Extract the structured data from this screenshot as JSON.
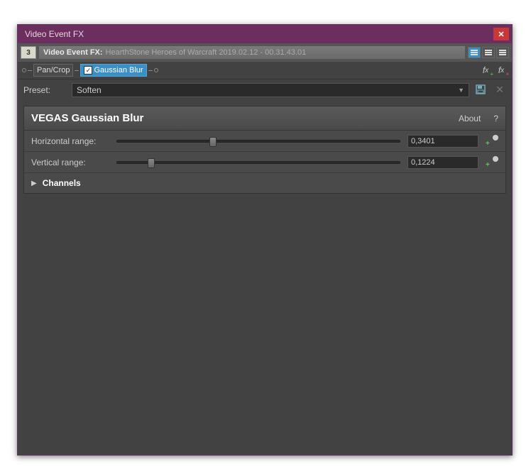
{
  "titlebar": {
    "title": "Video Event FX"
  },
  "chain": {
    "track_number": "3",
    "prefix": "Video Event FX:",
    "filename": "HearthStone Heroes of Warcraft 2019.02.12 - 00.31.43.01"
  },
  "fx_nodes": {
    "pancrop": "Pan/Crop",
    "gaussian": "Gaussian Blur"
  },
  "preset": {
    "label": "Preset:",
    "value": "Soften"
  },
  "panel": {
    "title": "VEGAS Gaussian Blur",
    "about": "About",
    "help": "?"
  },
  "params": {
    "horizontal": {
      "label": "Horizontal range:",
      "value": "0,3401",
      "percent": 34
    },
    "vertical": {
      "label": "Vertical range:",
      "value": "0,1224",
      "percent": 12
    }
  },
  "channels": {
    "label": "Channels"
  }
}
